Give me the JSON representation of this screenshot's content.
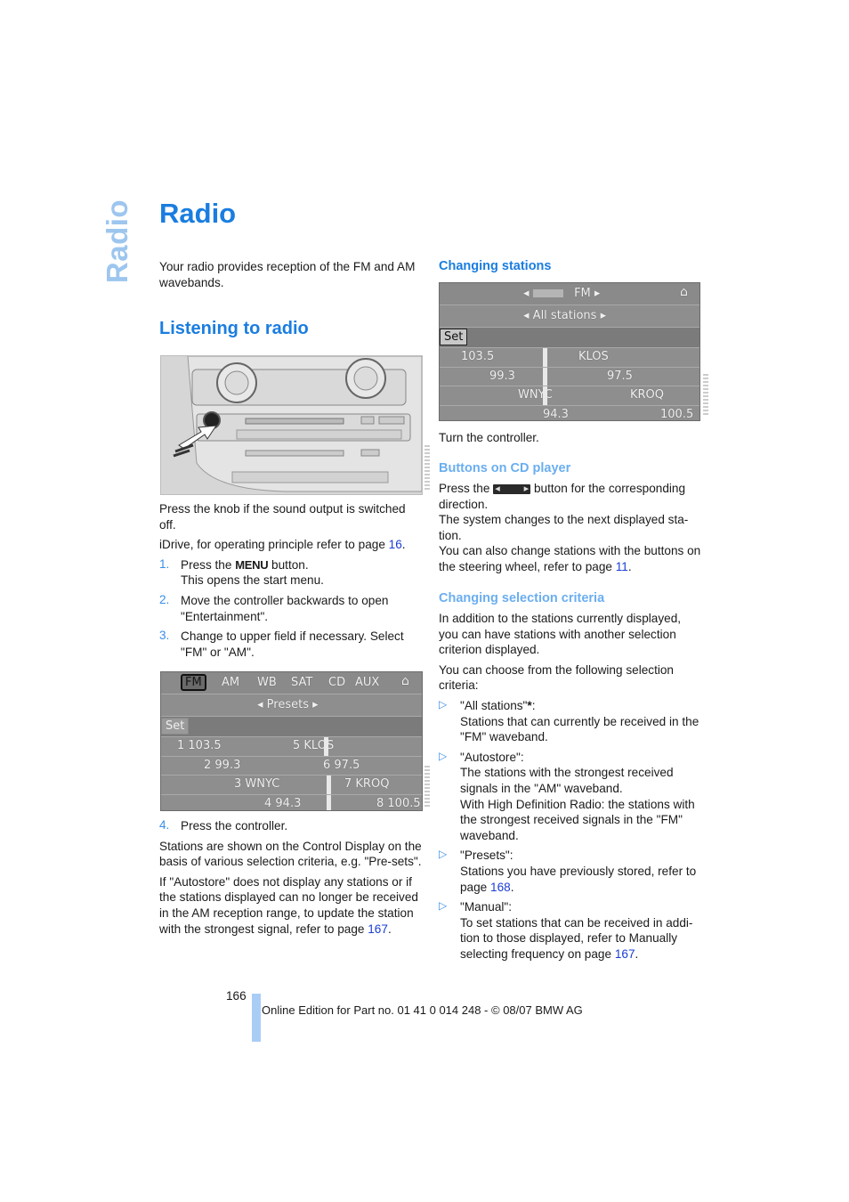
{
  "side_tab": "Radio",
  "page_title": "Radio",
  "left": {
    "intro": "Your radio provides reception of the FM and AM wavebands.",
    "section_title": "Listening to radio",
    "photo_caption_1": "Press the knob if the sound output is switched off.",
    "idrive_text": "iDrive, for operating principle refer to page ",
    "idrive_link": "16",
    "steps": [
      {
        "num": "1.",
        "pre": "Press the ",
        "glyph": "MENU",
        "post": " button.",
        "line2": "This opens the start menu."
      },
      {
        "num": "2.",
        "text": "Move the controller backwards to open \"Entertainment\"."
      },
      {
        "num": "3.",
        "text": "Change to upper field if necessary. Select \"FM\" or \"AM\"."
      },
      {
        "num": "4.",
        "text": "Press the controller."
      }
    ],
    "stations_text": "Stations are shown on the Control Display on the basis of various selection criteria, e.g. \"Pre-sets\".",
    "autostore_text": "If \"Autostore\" does not display any stations or if the stations displayed can no longer be received in the AM reception range, to update the station with the strongest signal, refer to page ",
    "autostore_link": "167"
  },
  "presets_screen": {
    "tabs": [
      "FM",
      "AM",
      "WB",
      "SAT",
      "CD",
      "AUX"
    ],
    "active_tab": "FM",
    "selection": "Presets",
    "set_label": "Set",
    "rows": [
      {
        "left": "1 103.5",
        "right": "5 KLOS"
      },
      {
        "left": "2 99.3",
        "right": "6 97.5"
      },
      {
        "left": "3 WNYC",
        "right": "7 KROQ"
      },
      {
        "left": "4 94.3",
        "right": "8 100.5"
      }
    ]
  },
  "right": {
    "changing_title": "Changing stations",
    "turn_text": "Turn the controller.",
    "cd_title": "Buttons on CD player",
    "cd_pre": "Press the ",
    "cd_post": " button for the corresponding direction.",
    "cd_next": "The system changes to the next displayed sta-tion.",
    "cd_steer": "You can also change stations with the buttons on the steering wheel, refer to page ",
    "cd_steer_link": "11",
    "criteria_title": "Changing selection criteria",
    "criteria_intro": "In addition to the stations currently displayed, you can have stations with another selection criterion displayed.",
    "criteria_choose": "You can choose from the following selection criteria:",
    "bullets": [
      {
        "label": "\"All stations\"",
        "star": "*",
        "colon": ":",
        "text": "Stations that can currently be received in the \"FM\" waveband."
      },
      {
        "label": "\"Autostore\":",
        "text": "The stations with the strongest received signals in the \"AM\" waveband.",
        "text2": "With High Definition Radio: the stations with the strongest received signals in the \"FM\" waveband."
      },
      {
        "label": "\"Presets\":",
        "text": "Stations you have previously stored, refer to page ",
        "link": "168"
      },
      {
        "label": "\"Manual\":",
        "text": "To set stations that can be received in addi-tion to those displayed, refer to Manually selecting frequency on page ",
        "link": "167"
      }
    ]
  },
  "stations_screen": {
    "band": "FM",
    "selection": "All stations",
    "set_label": "Set",
    "rows": [
      {
        "left": "103.5",
        "right": "KLOS"
      },
      {
        "left": "99.3",
        "right": "97.5"
      },
      {
        "left": "WNYC",
        "right": "KROQ"
      },
      {
        "left": "",
        "mid": "94.3",
        "right": "100.5"
      }
    ]
  },
  "footer": {
    "page_number": "166",
    "edition": "Online Edition for Part no. 01 41 0 014 248 - © 08/07 BMW AG"
  }
}
